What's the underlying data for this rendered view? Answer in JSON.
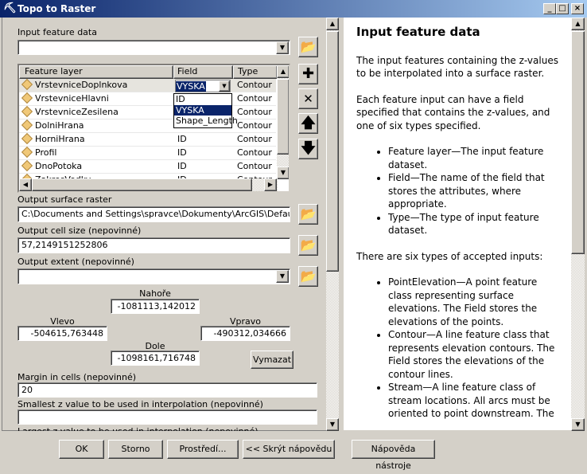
{
  "window": {
    "title": "Topo to Raster",
    "controls": [
      "_",
      "□",
      "×"
    ]
  },
  "input_feature_data": {
    "label": "Input feature data",
    "value": ""
  },
  "table": {
    "headers": [
      "Feature layer",
      "Field",
      "Type"
    ],
    "rows": [
      {
        "layer": "VrstevniceDoplnkova",
        "field": "VYSKA",
        "type": "Contour"
      },
      {
        "layer": "VrstevniceHlavni",
        "field": "ID",
        "type": "Contour"
      },
      {
        "layer": "VrstevniceZesilena",
        "field": "ID",
        "type": "Contour"
      },
      {
        "layer": "DolniHrana",
        "field": "ID",
        "type": "Contour"
      },
      {
        "layer": "HorniHrana",
        "field": "ID",
        "type": "Contour"
      },
      {
        "layer": "Profil",
        "field": "ID",
        "type": "Contour"
      },
      {
        "layer": "DnoPotoka",
        "field": "ID",
        "type": "Contour"
      },
      {
        "layer": "ZakresVodky",
        "field": "ID",
        "type": "Contour"
      }
    ],
    "field_dropdown": {
      "options": [
        "ID",
        "VYSKA",
        "Shape_Length"
      ],
      "selected": "VYSKA"
    }
  },
  "side_buttons": [
    "add",
    "remove",
    "move-up",
    "move-down"
  ],
  "output_surface_raster": {
    "label": "Output surface raster",
    "value": "C:\\Documents and Settings\\spravce\\Dokumenty\\ArcGIS\\Default.gdb\\"
  },
  "output_cell_size": {
    "label": "Output cell size (nepovinné)",
    "value": "57,2149151252806"
  },
  "output_extent": {
    "label": "Output extent (nepovinné)",
    "value": "",
    "top_label": "Nahoře",
    "top": "-1081113,142012",
    "left_label": "Vlevo",
    "left": "-504615,763448",
    "right_label": "Vpravo",
    "right": "-490312,034666",
    "bottom_label": "Dole",
    "bottom": "-1098161,716748",
    "clear": "Vymazat"
  },
  "margin": {
    "label": "Margin in cells (nepovinné)",
    "value": "20"
  },
  "smallest_z": {
    "label": "Smallest z value to be used in interpolation (nepovinné)",
    "value": ""
  },
  "largest_z": {
    "label": "Largest z value to be used in interpolation (nepovinné)"
  },
  "buttons": {
    "ok": "OK",
    "cancel": "Storno",
    "env": "Prostředí...",
    "hide_help": "<< Skrýt nápovědu",
    "tool_help": "Nápověda nástroje"
  },
  "help": {
    "title": "Input feature data",
    "p1": "The input features containing the z-values to be interpolated into a surface raster.",
    "p2": "Each feature input can have a field specified that contains the z-values, and one of six types specified.",
    "list1": [
      "Feature layer—The input feature dataset.",
      "Field—The name of the field that stores the attributes, where appropriate.",
      "Type—The type of input feature dataset."
    ],
    "p3": "There are six types of accepted inputs:",
    "list2": [
      "PointElevation—A point feature class representing surface elevations. The Field stores the elevations of the points.",
      "Contour—A line feature class that represents elevation contours. The Field stores the elevations of the contour lines.",
      "Stream—A line feature class of stream locations. All arcs must be oriented to point downstream. The"
    ]
  }
}
